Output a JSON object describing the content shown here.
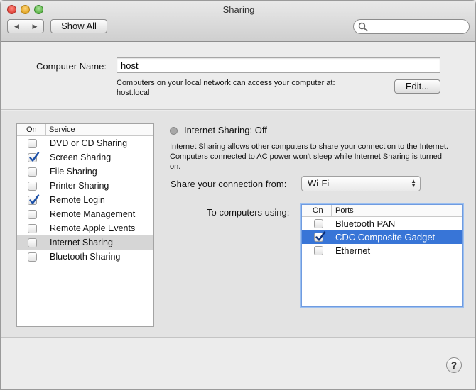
{
  "window": {
    "title": "Sharing"
  },
  "toolbar": {
    "back_glyph": "◀",
    "forward_glyph": "▶",
    "show_all_label": "Show All",
    "search_placeholder": ""
  },
  "computer_name": {
    "label": "Computer Name:",
    "value": "host",
    "description_line1": "Computers on your local network can access your computer at:",
    "description_line2": "host.local",
    "edit_label": "Edit..."
  },
  "services": {
    "header_on": "On",
    "header_service": "Service",
    "items": [
      {
        "label": "DVD or CD Sharing",
        "checked": false,
        "selected": false
      },
      {
        "label": "Screen Sharing",
        "checked": true,
        "selected": false
      },
      {
        "label": "File Sharing",
        "checked": false,
        "selected": false
      },
      {
        "label": "Printer Sharing",
        "checked": false,
        "selected": false
      },
      {
        "label": "Remote Login",
        "checked": true,
        "selected": false
      },
      {
        "label": "Remote Management",
        "checked": false,
        "selected": false
      },
      {
        "label": "Remote Apple Events",
        "checked": false,
        "selected": false
      },
      {
        "label": "Internet Sharing",
        "checked": false,
        "selected": true
      },
      {
        "label": "Bluetooth Sharing",
        "checked": false,
        "selected": false
      }
    ]
  },
  "detail": {
    "status_title": "Internet Sharing: Off",
    "status_color": "#a8a8a8",
    "description": "Internet Sharing allows other computers to share your connection to the Internet. Computers connected to AC power won't sleep while Internet Sharing is turned on.",
    "share_from_label": "Share your connection from:",
    "share_from_value": "Wi-Fi",
    "to_computers_label": "To computers using:",
    "ports_header_on": "On",
    "ports_header_ports": "Ports",
    "ports": [
      {
        "label": "Bluetooth PAN",
        "checked": false,
        "selected": false
      },
      {
        "label": "CDC Composite Gadget",
        "checked": true,
        "selected": true
      },
      {
        "label": "Ethernet",
        "checked": false,
        "selected": false
      }
    ]
  },
  "help": {
    "label": "?"
  },
  "colors": {
    "selection_blue": "#3875d7",
    "check_blue": "#1a4fa8"
  }
}
